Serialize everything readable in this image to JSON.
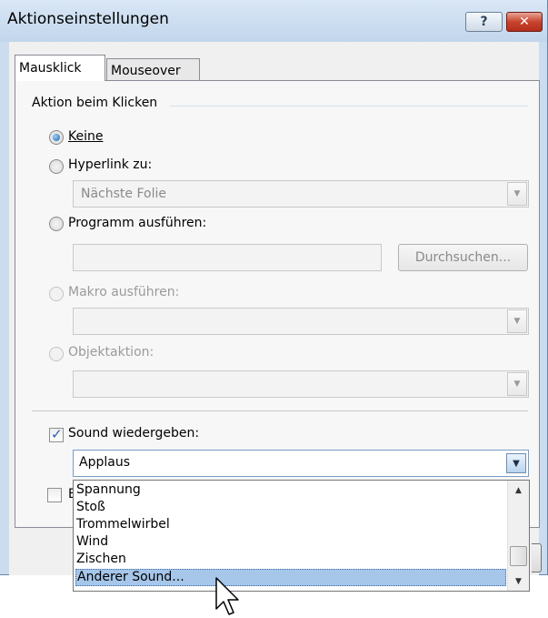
{
  "window": {
    "title": "Aktionseinstellungen"
  },
  "titlebar": {
    "help_glyph": "?",
    "close_glyph": "✕"
  },
  "tabs": [
    {
      "label": "Mausklick",
      "active": true
    },
    {
      "label": "Mouseover",
      "active": false
    }
  ],
  "group": {
    "title": "Aktion beim Klicken"
  },
  "options": {
    "none": {
      "label": "Keine",
      "checked": true
    },
    "hyperlink": {
      "label": "Hyperlink zu:",
      "value": "Nächste Folie"
    },
    "program": {
      "label": "Programm ausführen:",
      "value": "",
      "browse_label": "Durchsuchen..."
    },
    "macro": {
      "label": "Makro ausführen:",
      "value": ""
    },
    "object_action": {
      "label": "Objektaktion:",
      "value": ""
    }
  },
  "sound": {
    "checkbox_label": "Sound wiedergeben:",
    "checked": true,
    "selected_value": "Applaus",
    "list_items": [
      "Spannung",
      "Stoß",
      "Trommelwirbel",
      "Wind",
      "Zischen",
      "Anderer Sound..."
    ],
    "highlighted_item": "Anderer Sound..."
  },
  "hidden_option": {
    "label_visible": "E"
  },
  "icons": {
    "dropdown_arrow": "▼",
    "scroll_up": "▲",
    "scroll_down": "▼"
  },
  "colors": {
    "selection": "#a6c6ea",
    "close_button": "#c8442e",
    "title_bar": "#cbdcee"
  }
}
